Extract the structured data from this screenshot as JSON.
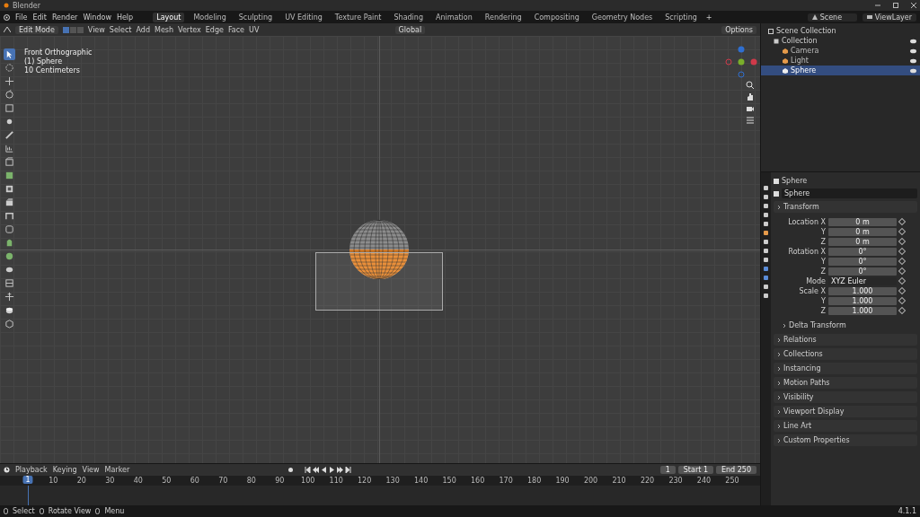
{
  "window": {
    "title": "Blender"
  },
  "menu": [
    "File",
    "Edit",
    "Render",
    "Window",
    "Help"
  ],
  "workspaces": [
    {
      "label": "Layout",
      "selected": true
    },
    {
      "label": "Modeling",
      "selected": false
    },
    {
      "label": "Sculpting",
      "selected": false
    },
    {
      "label": "UV Editing",
      "selected": false
    },
    {
      "label": "Texture Paint",
      "selected": false
    },
    {
      "label": "Shading",
      "selected": false
    },
    {
      "label": "Animation",
      "selected": false
    },
    {
      "label": "Rendering",
      "selected": false
    },
    {
      "label": "Compositing",
      "selected": false
    },
    {
      "label": "Geometry Nodes",
      "selected": false
    },
    {
      "label": "Scripting",
      "selected": false
    }
  ],
  "add_workspace": "+",
  "scene": "Scene",
  "view_layer": "ViewLayer",
  "viewport_header": {
    "mode": "Edit Mode",
    "select_modes": [
      {
        "selected": true
      },
      {
        "selected": false
      },
      {
        "selected": false
      }
    ],
    "menus": [
      "View",
      "Select",
      "Add",
      "Mesh",
      "Vertex",
      "Edge",
      "Face",
      "UV"
    ],
    "orientation": "Global",
    "options": "Options"
  },
  "tools": [
    {
      "selected": true
    },
    {
      "selected": false
    },
    {
      "selected": false
    },
    {
      "selected": false
    },
    {
      "selected": false
    },
    {
      "selected": false
    },
    {
      "selected": false
    },
    {
      "selected": false
    },
    {
      "selected": false
    },
    {
      "selected": false
    },
    {
      "selected": false
    },
    {
      "selected": false
    },
    {
      "selected": false
    },
    {
      "selected": false
    },
    {
      "selected": false
    },
    {
      "selected": false
    },
    {
      "selected": false
    },
    {
      "selected": false
    },
    {
      "selected": false
    },
    {
      "selected": false
    },
    {
      "selected": false
    }
  ],
  "viewport": {
    "view_name": "Front Orthographic",
    "object": "(1) Sphere",
    "scale": "10 Centimeters"
  },
  "outliner": {
    "root": "Scene Collection",
    "collection": "Collection",
    "objects": [
      {
        "name": "Camera",
        "selected": false
      },
      {
        "name": "Light",
        "selected": false
      },
      {
        "name": "Sphere",
        "selected": true
      }
    ]
  },
  "properties": {
    "object": "Sphere",
    "name_field": "Sphere",
    "transform": "Transform",
    "fields": [
      {
        "label": "Location X",
        "value": "0 m",
        "kind": "number"
      },
      {
        "label": "Y",
        "value": "0 m",
        "kind": "number"
      },
      {
        "label": "Z",
        "value": "0 m",
        "kind": "number"
      },
      {
        "label": "Rotation X",
        "value": "0°",
        "kind": "number"
      },
      {
        "label": "Y",
        "value": "0°",
        "kind": "number"
      },
      {
        "label": "Z",
        "value": "0°",
        "kind": "number"
      },
      {
        "label": "Mode",
        "value": "XYZ Euler",
        "kind": "dropdown"
      },
      {
        "label": "Scale X",
        "value": "1.000",
        "kind": "number"
      },
      {
        "label": "Y",
        "value": "1.000",
        "kind": "number"
      },
      {
        "label": "Z",
        "value": "1.000",
        "kind": "number"
      }
    ],
    "subsection": "Delta Transform",
    "sections": [
      "Relations",
      "Collections",
      "Instancing",
      "Motion Paths",
      "Visibility",
      "Viewport Display",
      "Line Art",
      "Custom Properties"
    ]
  },
  "timeline": {
    "menus": [
      "Playback",
      "Keying",
      "View",
      "Marker"
    ],
    "current_frame": "1",
    "start_label": "Start",
    "start": "1",
    "end_label": "End",
    "end": "250",
    "cursor": "1",
    "ruler": [
      "10",
      "20",
      "30",
      "40",
      "50",
      "60",
      "70",
      "80",
      "90",
      "100",
      "110",
      "120",
      "130",
      "140",
      "150",
      "160",
      "170",
      "180",
      "190",
      "200",
      "210",
      "220",
      "230",
      "240",
      "250"
    ]
  },
  "status_bar": {
    "hints": [
      "Select",
      "Rotate View",
      "Menu"
    ],
    "version": "4.1.1"
  }
}
